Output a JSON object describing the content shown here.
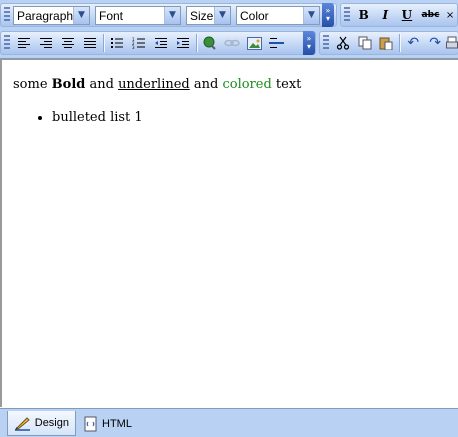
{
  "toolbar": {
    "paragraph": "Paragraph",
    "font": "Font",
    "size": "Size",
    "color": "Color",
    "bold": "B",
    "italic": "I",
    "underline": "U",
    "strike": "abc"
  },
  "editor": {
    "t1": "some ",
    "bold": "Bold",
    "t2": " and ",
    "underlined": "underlined",
    "t3": " and ",
    "colored": "colored",
    "t4": " text",
    "bullet1": "bulleted list 1",
    "colored_color": "#1a8c1a"
  },
  "tabs": {
    "design": "Design",
    "html": "HTML"
  }
}
